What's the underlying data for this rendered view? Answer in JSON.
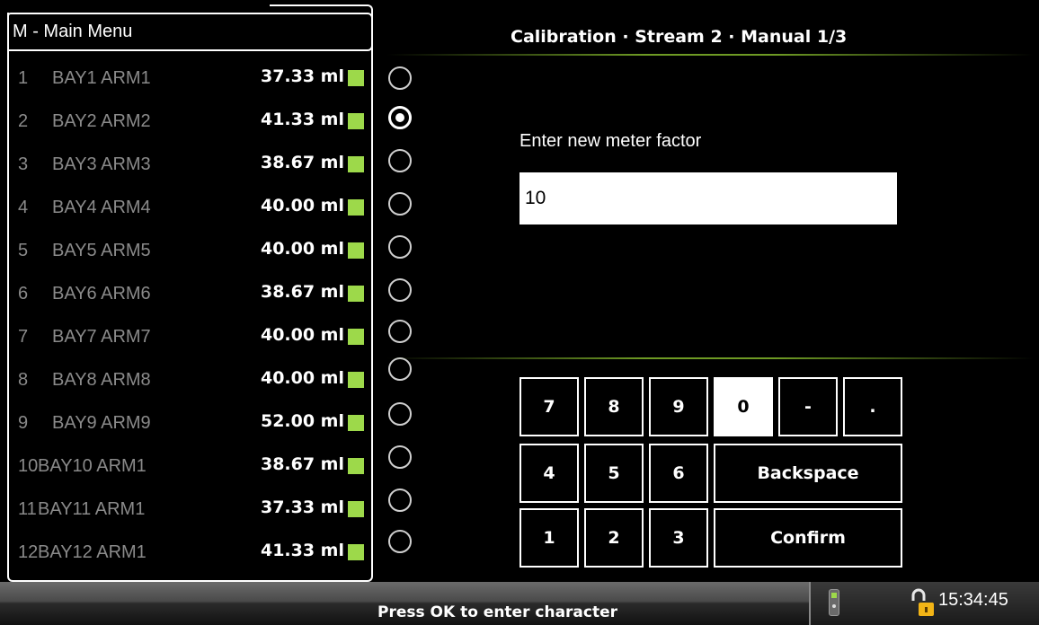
{
  "menu": {
    "title": "M - Main Menu"
  },
  "arms": [
    {
      "index": "1",
      "name": "BAY1 ARM1",
      "value": "37.33 ml"
    },
    {
      "index": "2",
      "name": "BAY2 ARM2",
      "value": "41.33 ml"
    },
    {
      "index": "3",
      "name": "BAY3 ARM3",
      "value": "38.67 ml"
    },
    {
      "index": "4",
      "name": "BAY4 ARM4",
      "value": "40.00 ml"
    },
    {
      "index": "5",
      "name": "BAY5 ARM5",
      "value": "40.00 ml"
    },
    {
      "index": "6",
      "name": "BAY6 ARM6",
      "value": "38.67 ml"
    },
    {
      "index": "7",
      "name": "BAY7 ARM7",
      "value": "40.00 ml"
    },
    {
      "index": "8",
      "name": "BAY8 ARM8",
      "value": "40.00 ml"
    },
    {
      "index": "9",
      "name": "BAY9 ARM9",
      "value": "52.00 ml"
    },
    {
      "index": "10",
      "name": "BAY10 ARM1",
      "value": "38.67 ml"
    },
    {
      "index": "11",
      "name": "BAY11 ARM1",
      "value": "37.33 ml"
    },
    {
      "index": "12",
      "name": "BAY12 ARM1",
      "value": "41.33 ml"
    }
  ],
  "selected_arm_index": 2,
  "status_color": "#9dd94a",
  "screen": {
    "title": "Calibration · Stream 2 · Manual 1/3",
    "prompt": "Enter new meter factor",
    "input_value": "10"
  },
  "keypad": {
    "k7": "7",
    "k8": "8",
    "k9": "9",
    "k0": "0",
    "dash": "-",
    "dot": ".",
    "k4": "4",
    "k5": "5",
    "k6": "6",
    "backspace": "Backspace",
    "k1": "1",
    "k2": "2",
    "k3": "3",
    "confirm": "Confirm",
    "active_key": "0"
  },
  "status_bar": {
    "message": "Press OK to enter character",
    "time": "15:34:45"
  }
}
